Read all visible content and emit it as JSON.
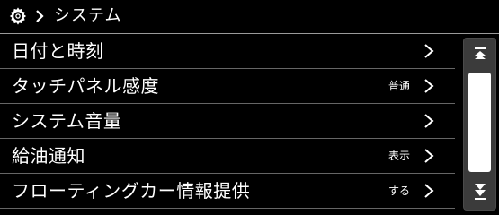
{
  "header": {
    "icon": "gear-icon",
    "separator_icon": "chevron-right-icon",
    "title": "システム"
  },
  "menu": {
    "items": [
      {
        "label": "日付と時刻",
        "value": ""
      },
      {
        "label": "タッチパネル感度",
        "value": "普通"
      },
      {
        "label": "システム音量",
        "value": ""
      },
      {
        "label": "給油通知",
        "value": "表示"
      },
      {
        "label": "フローティングカー情報提供",
        "value": "する"
      }
    ]
  },
  "scrollbar": {
    "up_icon": "scroll-top-icon",
    "down_icon": "scroll-down-icon"
  },
  "colors": {
    "background": "#000000",
    "text": "#ffffff",
    "divider": "#666666",
    "scroll_track": "#3b3b3b",
    "scroll_thumb": "#ffffff"
  }
}
